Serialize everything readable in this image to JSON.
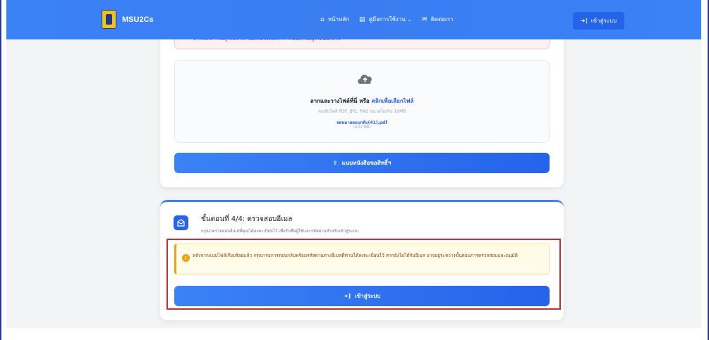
{
  "nav": {
    "brand": "MSU2Cs",
    "links": [
      {
        "icon": "home-icon",
        "glyph": "⌂",
        "label": "หน้าหลัก"
      },
      {
        "icon": "book-icon",
        "glyph": "▤",
        "label": "คู่มือการใช้งาน ⌄"
      },
      {
        "icon": "mail-icon",
        "glyph": "✉",
        "label": "ติดต่อเรา"
      }
    ],
    "login_label": "เข้าสู่ระบบ",
    "login_icon": "login-icon"
  },
  "upload": {
    "warning_text": "หากเอกสารไม่ถูกต้อง สถานะเดิมจะต้องทำการบันทึกข้อมูลใหม่อีกครั้ง",
    "drop_title": "ลากและวางไฟล์ที่นี่ หรือ",
    "drop_link": "คลิกเพื่อเลือกไฟล์",
    "drop_hint": "รองรับไฟล์ PDF, JPG, PNG ขนาดไม่เกิน 10MB",
    "file_name": "จดหมายตอบกลับ(41).pdf",
    "file_size": "(0.02 MB)",
    "attach_label": "แนบหนังสือขอสิทธิ์ฯ"
  },
  "step4": {
    "title": "ขั้นตอนที่ 4/4: ตรวจสอบอีเมล",
    "subtitle": "กรุณาตรวจสอบอีเมลที่คุณได้ลงทะเบียนไว้ เพื่อรับชื่อผู้ใช้และรหัสผ่านสำหรับเข้าสู่ระบบ",
    "info_text": "หลังจากแนบไฟล์เรียบร้อยแล้ว กรุณารอการตอบกลับพร้อมรหัสผ่านทางอีเมลที่ท่านได้ลงทะเบียนไว้ หากยังไม่ได้รับอีเมล อาจอยู่ระหว่างขั้นตอนการตรวจสอบและอนุมัติ",
    "login_label": "เข้าสู่ระบบ"
  },
  "colors": {
    "primary": "#3b82f6",
    "warning_bg": "#fefce8",
    "error": "#dc2626",
    "highlight": "#dc2626"
  }
}
